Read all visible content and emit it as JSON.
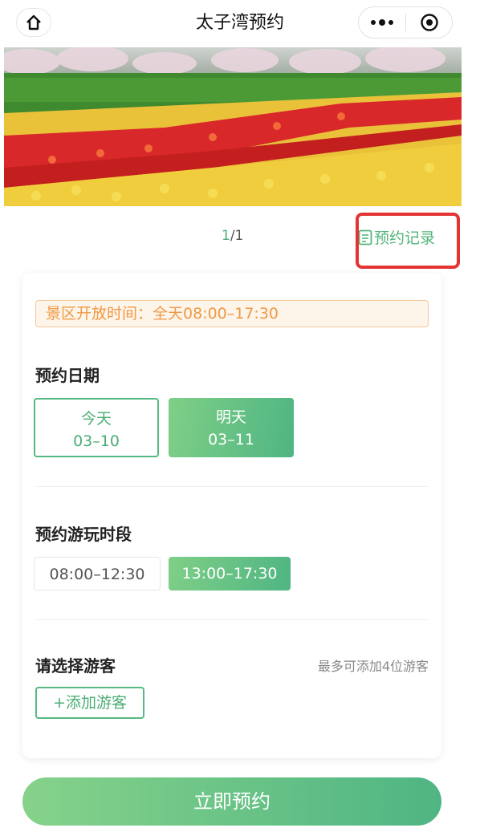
{
  "nav": {
    "title": "太子湾预约",
    "home_icon": "home-icon",
    "more_icon": "more-dots-icon",
    "close_icon": "capsule-close-icon"
  },
  "banner": {
    "image": "tulip-field-photo"
  },
  "pager": {
    "current": "1",
    "separator_total": "/1"
  },
  "record_link": {
    "label": "预约记录",
    "icon": "document-icon"
  },
  "annotation": {
    "box_color": "#e53232",
    "arrow_color": "#e53232"
  },
  "notice": {
    "text": "景区开放时间：全天08:00–17:30"
  },
  "date_section": {
    "title": "预约日期",
    "options": [
      {
        "day": "今天",
        "date": "03–10",
        "selected": false
      },
      {
        "day": "明天",
        "date": "03–11",
        "selected": true
      }
    ]
  },
  "slot_section": {
    "title": "预约游玩时段",
    "options": [
      {
        "label": "08:00–12:30",
        "selected": false
      },
      {
        "label": "13:00–17:30",
        "selected": true
      }
    ]
  },
  "visitor_section": {
    "title": "请选择游客",
    "hint": "最多可添加4位游客",
    "add_label": "+添加游客"
  },
  "submit": {
    "label": "立即预约"
  },
  "colors": {
    "accent": "#52b57b",
    "notice_text": "#ef9a45",
    "notice_bg": "#fdf4ea"
  }
}
